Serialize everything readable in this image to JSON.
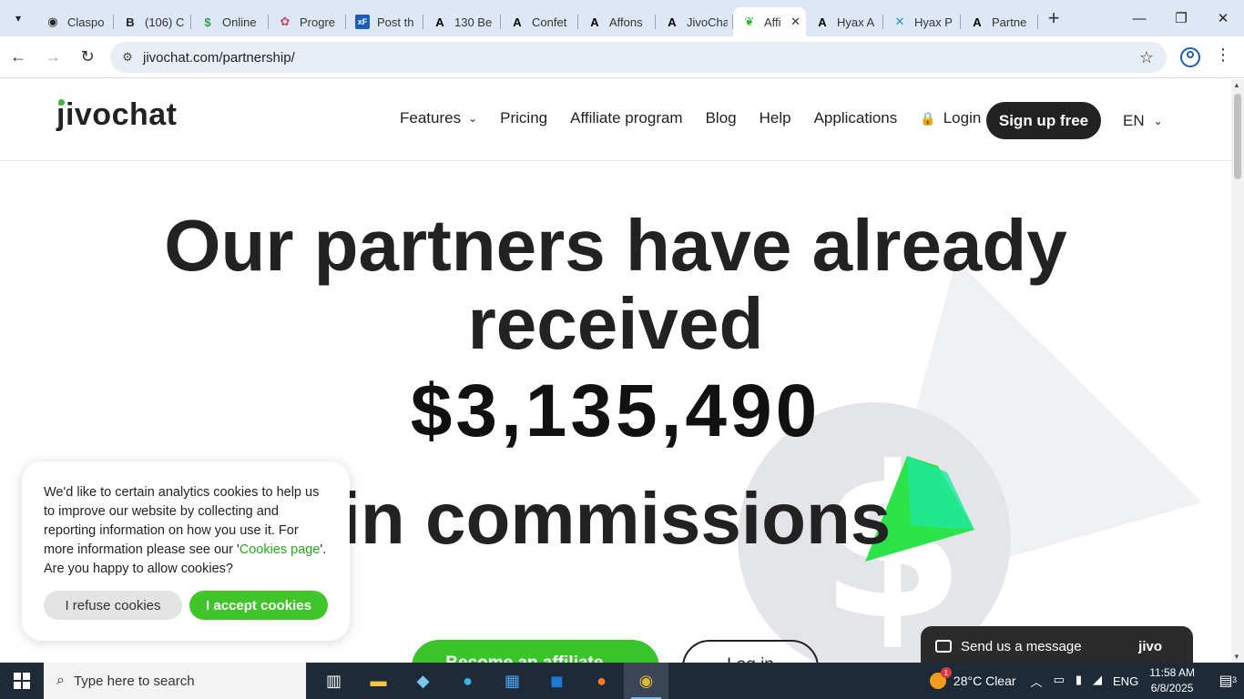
{
  "browser": {
    "tabs": [
      {
        "title": "Claspo",
        "icon": "claspo-icon"
      },
      {
        "title": "(106) C",
        "icon": "b-icon"
      },
      {
        "title": "Online",
        "icon": "dollar-icon"
      },
      {
        "title": "Progre",
        "icon": "progress-icon"
      },
      {
        "title": "Post th",
        "icon": "xf-icon"
      },
      {
        "title": "130 Be",
        "icon": "a-icon"
      },
      {
        "title": "Confet",
        "icon": "a-icon"
      },
      {
        "title": "Affons",
        "icon": "a-icon"
      },
      {
        "title": "JivoCha",
        "icon": "a-icon"
      },
      {
        "title": "Affi",
        "icon": "leaf-icon",
        "active": true
      },
      {
        "title": "Hyax A",
        "icon": "a-icon"
      },
      {
        "title": "Hyax P",
        "icon": "x-icon"
      },
      {
        "title": "Partne",
        "icon": "a-icon"
      }
    ],
    "url": "jivochat.com/partnership/"
  },
  "site": {
    "logo": "jivochat",
    "nav": {
      "features": "Features",
      "pricing": "Pricing",
      "affiliate": "Affiliate program",
      "blog": "Blog",
      "help": "Help",
      "applications": "Applications",
      "login": "Login"
    },
    "signup": "Sign up free",
    "lang": "EN"
  },
  "hero": {
    "line1": "Our partners have already",
    "line2": "received",
    "amount": "$3,135,490",
    "line3": "in commissions",
    "cta_primary": "Become an affiliate →",
    "cta_secondary": "Log in"
  },
  "cookie": {
    "text_before": "We'd like to certain analytics cookies to help us to improve our website by collecting and reporting information on how you use it. For more information please see our '",
    "link": "Cookies page",
    "text_after": "'. Are you happy to allow cookies?",
    "refuse": "I refuse cookies",
    "accept": "I accept cookies"
  },
  "chat": {
    "message": "Send us a message",
    "brand": "jivo"
  },
  "taskbar": {
    "search_placeholder": "Type here to search",
    "weather": "28°C  Clear",
    "weather_badge": "1",
    "language": "ENG",
    "time": "11:58 AM",
    "date": "6/8/2025",
    "notifications": "3"
  },
  "colors": {
    "brand_green": "#39c52a",
    "dark": "#222222",
    "tabstrip": "#dde7f5"
  }
}
